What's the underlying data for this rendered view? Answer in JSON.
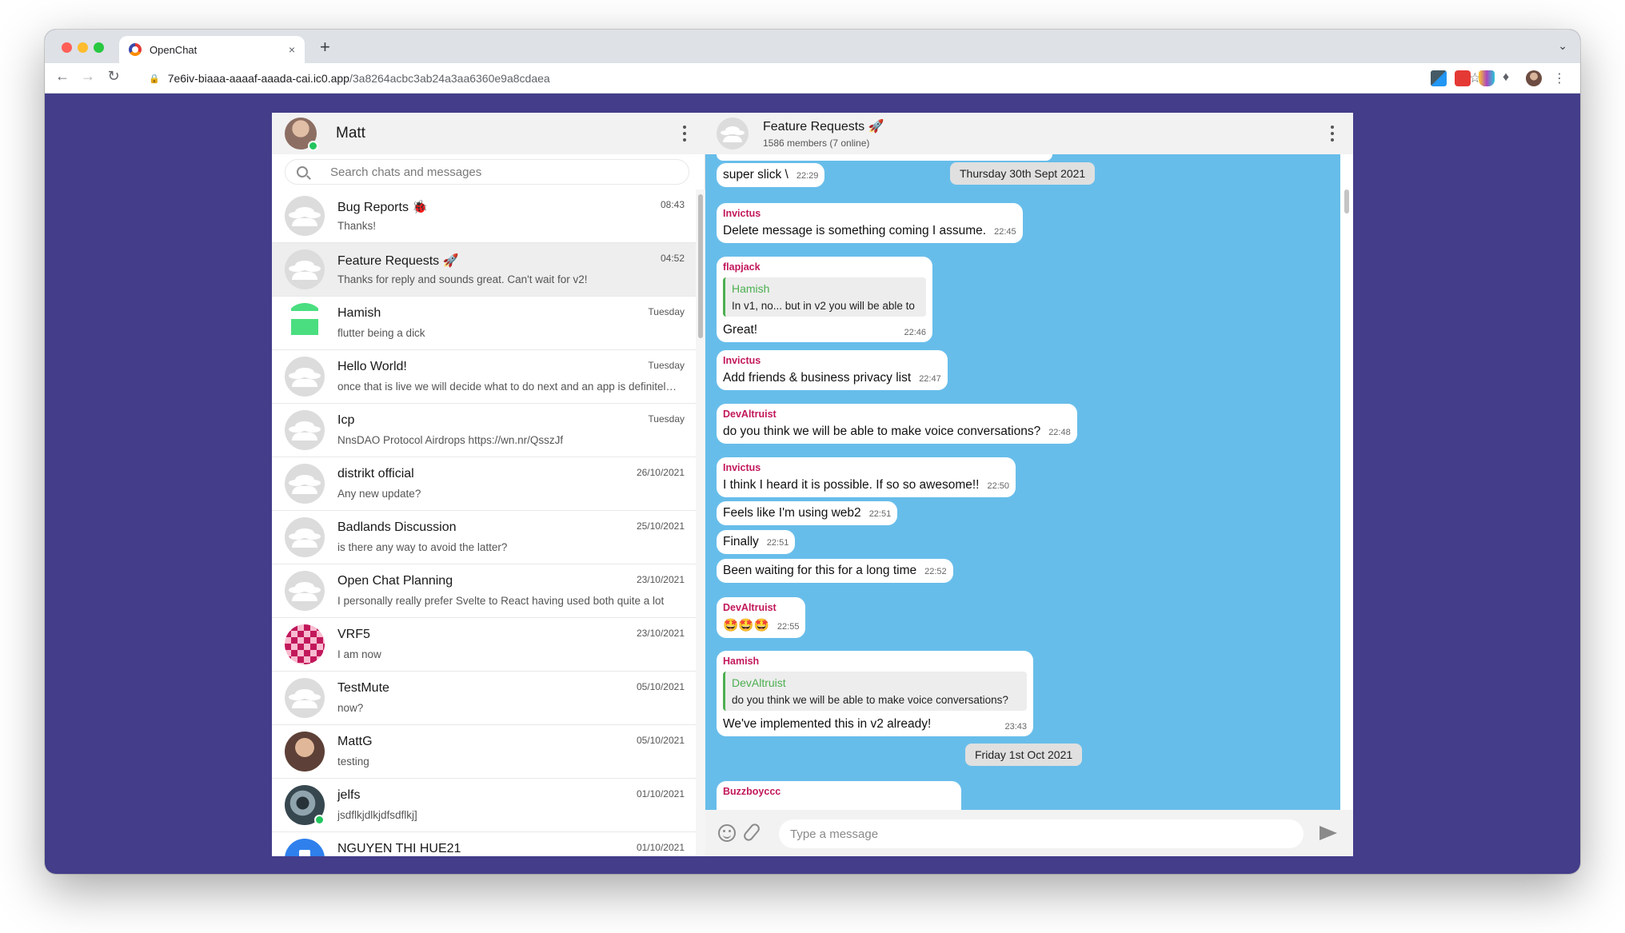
{
  "browser": {
    "tab_title": "OpenChat",
    "tab_close": "×",
    "new_tab": "+",
    "tab_menu": "⌄",
    "url_host": "7e6iv-biaaa-aaaaf-aaada-cai.ic0.app",
    "url_path": "/3a8264acbc3ab24a3aa6360e9a8cdaea"
  },
  "sidebar": {
    "user_name": "Matt",
    "search_placeholder": "Search chats and messages",
    "chats": [
      {
        "name": "Bug Reports 🐞",
        "time": "08:43",
        "last": "Thanks!",
        "avatar": "group"
      },
      {
        "name": "Feature Requests 🚀",
        "time": "04:52",
        "last": "Thanks for reply and sounds great. Can't wait for v2!",
        "avatar": "group",
        "active": true
      },
      {
        "name": "Hamish",
        "time": "Tuesday",
        "last": "flutter being a dick",
        "avatar": "hamish"
      },
      {
        "name": "Hello World!",
        "time": "Tuesday",
        "last": "once that is live we will decide what to do next and an app is definitely on the list",
        "avatar": "group"
      },
      {
        "name": "Icp",
        "time": "Tuesday",
        "last": "NnsDAO Protocol Airdrops https://wn.nr/QsszJf",
        "avatar": "group"
      },
      {
        "name": "distrikt official",
        "time": "26/10/2021",
        "last": "Any new update?",
        "avatar": "group"
      },
      {
        "name": "Badlands Discussion",
        "time": "25/10/2021",
        "last": "is there any way to avoid the latter?",
        "avatar": "group"
      },
      {
        "name": "Open Chat Planning",
        "time": "23/10/2021",
        "last": "I personally really prefer Svelte to React having used both quite a lot",
        "avatar": "group"
      },
      {
        "name": "VRF5",
        "time": "23/10/2021",
        "last": "I am now",
        "avatar": "vrf"
      },
      {
        "name": "TestMute",
        "time": "05/10/2021",
        "last": "now?",
        "avatar": "group"
      },
      {
        "name": "MattG",
        "time": "05/10/2021",
        "last": "testing",
        "avatar": "photo-mattg"
      },
      {
        "name": "jelfs",
        "time": "01/10/2021",
        "last": "jsdflkjdlkjdfsdflkj]",
        "avatar": "photo-jelfs",
        "online": true
      },
      {
        "name": "NGUYEN THI HUE21",
        "time": "01/10/2021",
        "last": "",
        "avatar": "nguyen"
      }
    ]
  },
  "conversation": {
    "title": "Feature Requests 🚀",
    "subtitle": "1586 members (7 online)",
    "input_placeholder": "Type a message",
    "date_pills": [
      "Thursday 30th Sept 2021",
      "Friday 1st Oct 2021"
    ],
    "messages": [
      {
        "sender": "",
        "text": "super slick \\",
        "time": "22:29"
      },
      {
        "sender": "Invictus",
        "text": "Delete message is something coming I assume.",
        "time": "22:45"
      },
      {
        "sender": "flapjack",
        "quote_sender": "Hamish",
        "quote_text": "In v1, no... but in v2 you will be able to",
        "text": "Great!",
        "time": "22:46"
      },
      {
        "sender": "Invictus",
        "text": "Add friends & business privacy list",
        "time": "22:47"
      },
      {
        "sender": "DevAltruist",
        "text": "do you think we will be able to make voice conversations?",
        "time": "22:48"
      },
      {
        "sender": "Invictus",
        "text": "I think I heard it is possible. If so so awesome!!",
        "time": "22:50"
      },
      {
        "sender": "",
        "text": "Feels like I'm using web2",
        "time": "22:51"
      },
      {
        "sender": "",
        "text": "Finally",
        "time": "22:51"
      },
      {
        "sender": "",
        "text": "Been waiting for this for a long time",
        "time": "22:52"
      },
      {
        "sender": "DevAltruist",
        "text": "🤩🤩🤩",
        "time": "22:55"
      },
      {
        "sender": "Hamish",
        "quote_sender": "DevAltruist",
        "quote_text": "do you think we will be able to make voice conversations?",
        "text": "We've implemented this in v2 already!",
        "time": "23:43"
      },
      {
        "sender": "Buzzboyccc",
        "text": "",
        "time": ""
      }
    ]
  }
}
